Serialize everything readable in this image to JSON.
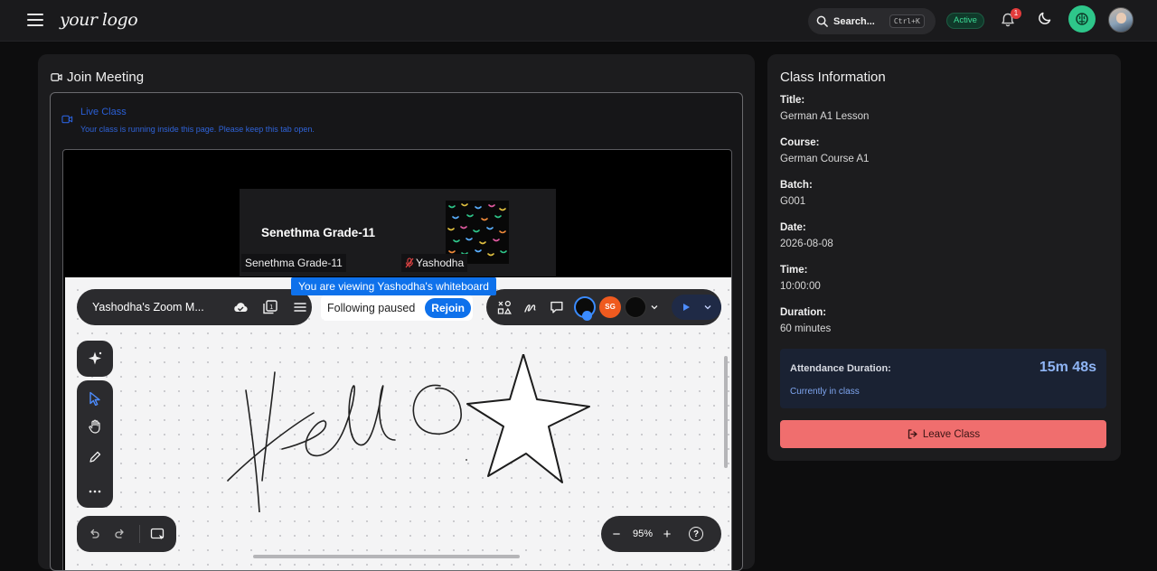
{
  "header": {
    "logo_text": "your logo",
    "search_label": "Search...",
    "search_shortcut": "Ctrl+K",
    "status_badge": "Active",
    "notification_count": "1",
    "icons": [
      "menu-icon",
      "search-icon",
      "bell-icon",
      "moon-icon",
      "brain-icon",
      "avatar"
    ]
  },
  "meeting": {
    "title": "Join Meeting",
    "live_title": "Live Class",
    "live_subtitle": "Your class is running inside this page. Please keep this tab open.",
    "participants": [
      {
        "display": "Senethma Grade-11",
        "name_tag": "Senethma Grade-11"
      },
      {
        "name_tag": "Yashodha",
        "muted": true
      }
    ],
    "viewing_banner": "You are viewing Yashodha's whiteboard",
    "whiteboard": {
      "name": "Yashodha's Zoom M...",
      "following_status": "Following paused",
      "rejoin_label": "Rejoin",
      "participant_initials": "SG",
      "zoom_level": "95%",
      "zoom_minus": "−",
      "zoom_plus": "+",
      "help": "?"
    }
  },
  "class_info": {
    "title": "Class Information",
    "fields": [
      {
        "label": "Title:",
        "value": "German A1 Lesson"
      },
      {
        "label": "Course:",
        "value": "German Course A1"
      },
      {
        "label": "Batch:",
        "value": "G001"
      },
      {
        "label": "Date:",
        "value": "2026-08-08"
      },
      {
        "label": "Time:",
        "value": "10:00:00"
      },
      {
        "label": "Duration:",
        "value": "60 minutes"
      }
    ],
    "attendance": {
      "label": "Attendance Duration:",
      "value": "15m 48s",
      "status": "Currently in class"
    },
    "leave_button": "Leave Class"
  },
  "colors": {
    "accent_blue": "#0e71eb",
    "success_green": "#2ec68a",
    "danger_red": "#f06e6e"
  }
}
